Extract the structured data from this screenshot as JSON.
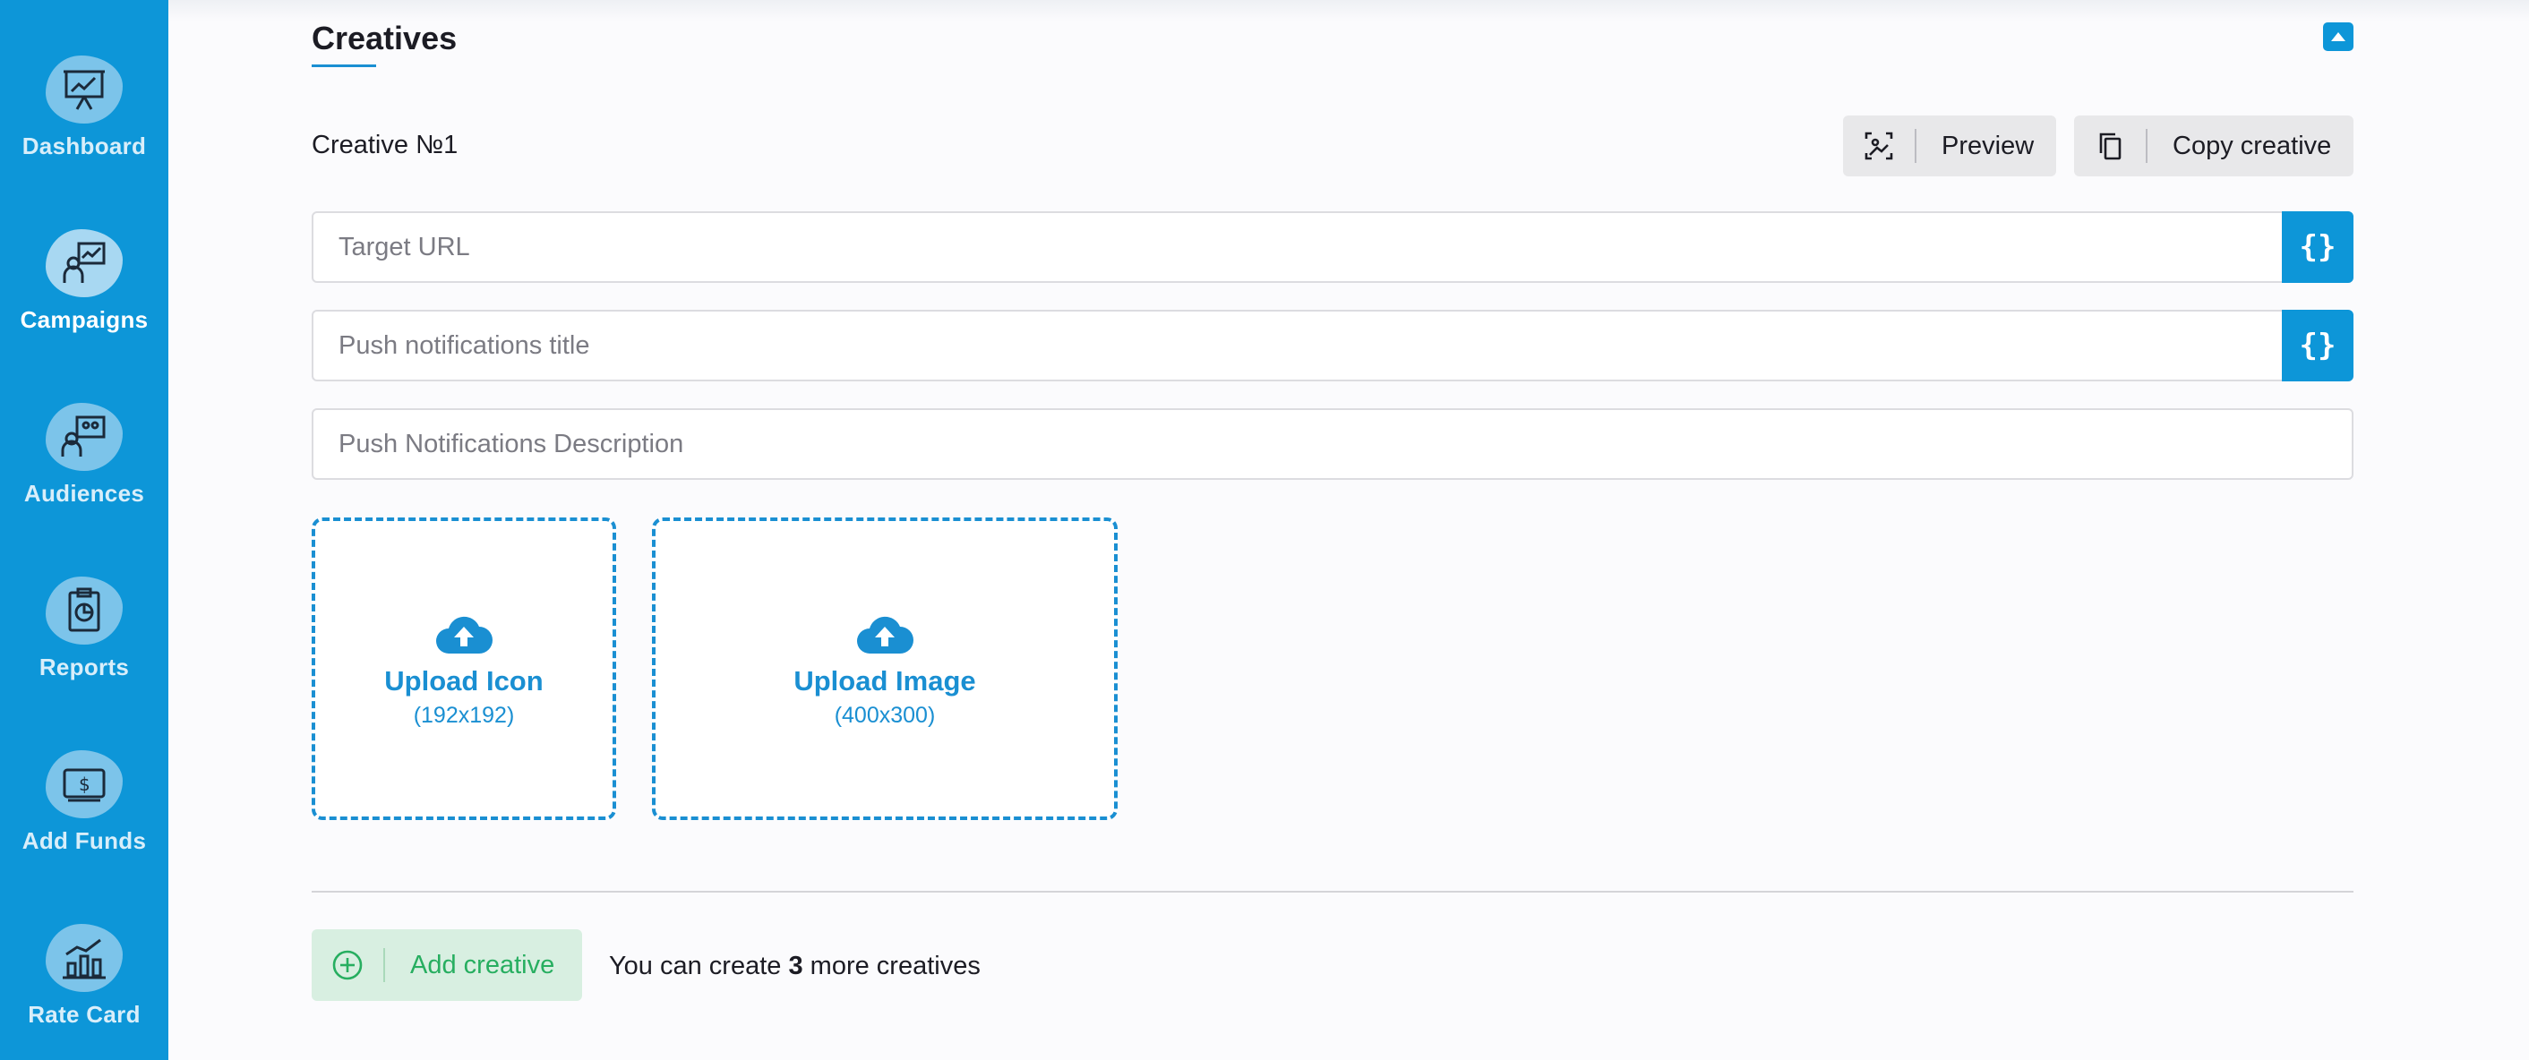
{
  "sidebar": {
    "items": [
      {
        "label": "Dashboard",
        "icon": "presentation-chart-icon",
        "active": false
      },
      {
        "label": "Campaigns",
        "icon": "campaign-chart-icon",
        "active": true
      },
      {
        "label": "Audiences",
        "icon": "audience-icon",
        "active": false
      },
      {
        "label": "Reports",
        "icon": "report-clipboard-icon",
        "active": false
      },
      {
        "label": "Add Funds",
        "icon": "money-icon",
        "active": false
      },
      {
        "label": "Rate Card",
        "icon": "bar-chart-icon",
        "active": false
      }
    ]
  },
  "section": {
    "title": "Creatives"
  },
  "creative": {
    "name": "Creative №1",
    "preview_label": "Preview",
    "copy_label": "Copy creative",
    "target_url_placeholder": "Target URL",
    "push_title_placeholder": "Push notifications title",
    "push_description_placeholder": "Push Notifications Description",
    "macro_symbol": "{}",
    "upload_icon": {
      "label": "Upload Icon",
      "size": "(192x192)"
    },
    "upload_image": {
      "label": "Upload Image",
      "size": "(400x300)"
    }
  },
  "footer": {
    "add_label": "Add creative",
    "note_prefix": "You can create ",
    "note_count": "3",
    "note_suffix": " more creatives"
  },
  "colors": {
    "primary": "#0d96d8",
    "success": "#27ae60",
    "success_bg": "#d8efe1"
  }
}
